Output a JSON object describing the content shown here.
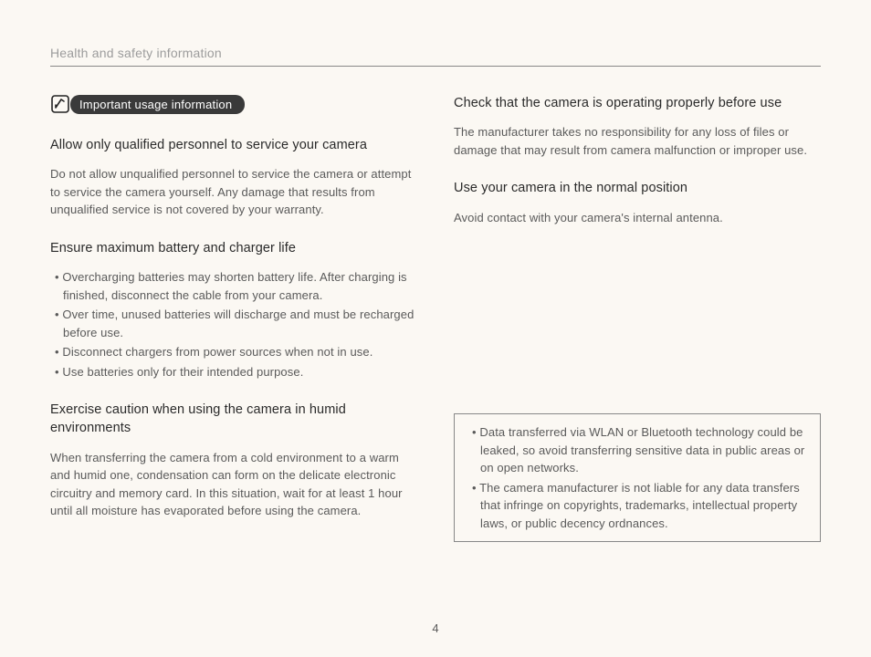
{
  "header": "Health and safety information",
  "badge": "Important usage information",
  "left": {
    "section1": {
      "title": "Allow only qualified personnel to service your camera",
      "body": "Do not allow unqualified personnel to service the camera or attempt to service the camera yourself. Any damage that results from unqualified service is not covered by your warranty."
    },
    "section2": {
      "title": "Ensure maximum battery and charger life",
      "items": [
        "Overcharging batteries may shorten battery life. After charging is finished, disconnect the cable from your camera.",
        "Over time, unused batteries will discharge and must be recharged before use.",
        "Disconnect chargers from power sources when not in use.",
        "Use batteries only for their intended purpose."
      ]
    },
    "section3": {
      "title": "Exercise caution when using the camera in humid environments",
      "body": "When transferring the camera from a cold environment to a warm and humid one, condensation can form on the delicate electronic circuitry and memory card. In this situation, wait for at least 1 hour until all moisture has evaporated before using the camera."
    }
  },
  "right": {
    "section1": {
      "title": "Check that the camera is operating properly before use",
      "body": "The manufacturer takes no responsibility for any loss of files or damage that may result from camera malfunction or improper use."
    },
    "section2": {
      "title": "Use your camera in the normal position",
      "body": "Avoid contact with your camera's internal antenna."
    },
    "infobox": {
      "items": [
        "Data transferred via WLAN or Bluetooth technology could be leaked, so avoid transferring sensitive data in public areas or on open networks.",
        "The camera manufacturer is not liable for any data transfers that infringe on copyrights, trademarks, intellectual property laws, or public decency ordnances."
      ]
    }
  },
  "pageNumber": "4"
}
